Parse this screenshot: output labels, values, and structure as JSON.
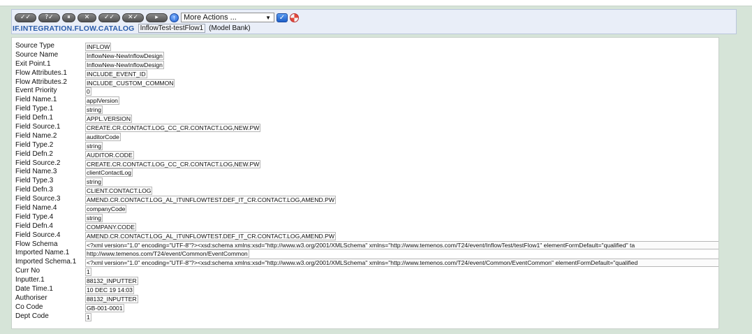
{
  "toolbar": {
    "buttons": [
      {
        "label": "✓✓",
        "name": "validate-button"
      },
      {
        "label": "?✓",
        "name": "hold-button"
      },
      {
        "label": "⏸",
        "name": "pause-button"
      },
      {
        "label": "✕",
        "name": "delete-button"
      },
      {
        "label": "✓✓",
        "name": "authorise-button"
      },
      {
        "label": "✕✓",
        "name": "reverse-button"
      },
      {
        "label": "▸",
        "name": "next-button"
      }
    ],
    "up_icon": "↑",
    "more_actions": {
      "selected": "More Actions ..."
    },
    "go_icon": "✓"
  },
  "breadcrumb": {
    "app": "IF.INTEGRATION.FLOW.CATALOG",
    "record_id": "InflowTest-testFlow1",
    "company": "(Model Bank)"
  },
  "fields": [
    {
      "label": "Source Type",
      "value": "INFLOW"
    },
    {
      "label": "Source Name",
      "value": "InflowNew-NewInflowDesign"
    },
    {
      "label": "Exit Point.1",
      "value": "InflowNew-NewInflowDesign"
    },
    {
      "label": "Flow Attributes.1",
      "value": "INCLUDE_EVENT_ID"
    },
    {
      "label": "Flow Attributes.2",
      "value": "INCLUDE_CUSTOM_COMMON"
    },
    {
      "label": "Event Priority",
      "value": "0"
    },
    {
      "label": "Field Name.1",
      "value": "applVersion"
    },
    {
      "label": "Field Type.1",
      "value": "string"
    },
    {
      "label": "Field Defn.1",
      "value": "APPL.VERSION"
    },
    {
      "label": "Field Source.1",
      "value": "CREATE.CR.CONTACT.LOG_CC_CR.CONTACT.LOG,NEW.PW"
    },
    {
      "label": "Field Name.2",
      "value": "auditorCode"
    },
    {
      "label": "Field Type.2",
      "value": "string"
    },
    {
      "label": "Field Defn.2",
      "value": "AUDITOR.CODE"
    },
    {
      "label": "Field Source.2",
      "value": "CREATE.CR.CONTACT.LOG_CC_CR.CONTACT.LOG,NEW.PW"
    },
    {
      "label": "Field Name.3",
      "value": "clientContactLog"
    },
    {
      "label": "Field Type.3",
      "value": "string"
    },
    {
      "label": "Field Defn.3",
      "value": "CLIENT.CONTACT.LOG"
    },
    {
      "label": "Field Source.3",
      "value": "AMEND.CR.CONTACT.LOG_AL_IT\\INFLOWTEST.DEF_IT_CR.CONTACT.LOG,AMEND.PW"
    },
    {
      "label": "Field Name.4",
      "value": "companyCode"
    },
    {
      "label": "Field Type.4",
      "value": "string"
    },
    {
      "label": "Field Defn.4",
      "value": "COMPANY.CODE"
    },
    {
      "label": "Field Source.4",
      "value": "AMEND.CR.CONTACT.LOG_AL_IT\\INFLOWTEST.DEF_IT_CR.CONTACT.LOG,AMEND.PW"
    },
    {
      "label": "Flow Schema",
      "value": "<?xml version=\"1.0\" encoding=\"UTF-8\"?><xsd:schema xmlns:xsd=\"http://www.w3.org/2001/XMLSchema\" xmlns=\"http://www.temenos.com/T24/event/InflowTest/testFlow1\" elementFormDefault=\"qualified\" ta",
      "long": true
    },
    {
      "label": "Imported Name.1",
      "value": "http://www.temenos.com/T24/event/Common/EventCommon"
    },
    {
      "label": "Imported Schema.1",
      "value": "<?xml version=\"1.0\" encoding=\"UTF-8\"?><xsd:schema xmlns:xsd=\"http://www.w3.org/2001/XMLSchema\" xmlns=\"http://www.temenos.com/T24/event/Common/EventCommon\" elementFormDefault=\"qualified",
      "long": true
    },
    {
      "label": "Curr No",
      "value": "1"
    },
    {
      "label": "Inputter.1",
      "value": "88132_INPUTTER"
    },
    {
      "label": "Date Time.1",
      "value": "10 DEC 19 14:03"
    },
    {
      "label": "Authoriser",
      "value": "88132_INPUTTER"
    },
    {
      "label": "Co Code",
      "value": "GB-001-0001"
    },
    {
      "label": "Dept Code",
      "value": "1"
    }
  ]
}
